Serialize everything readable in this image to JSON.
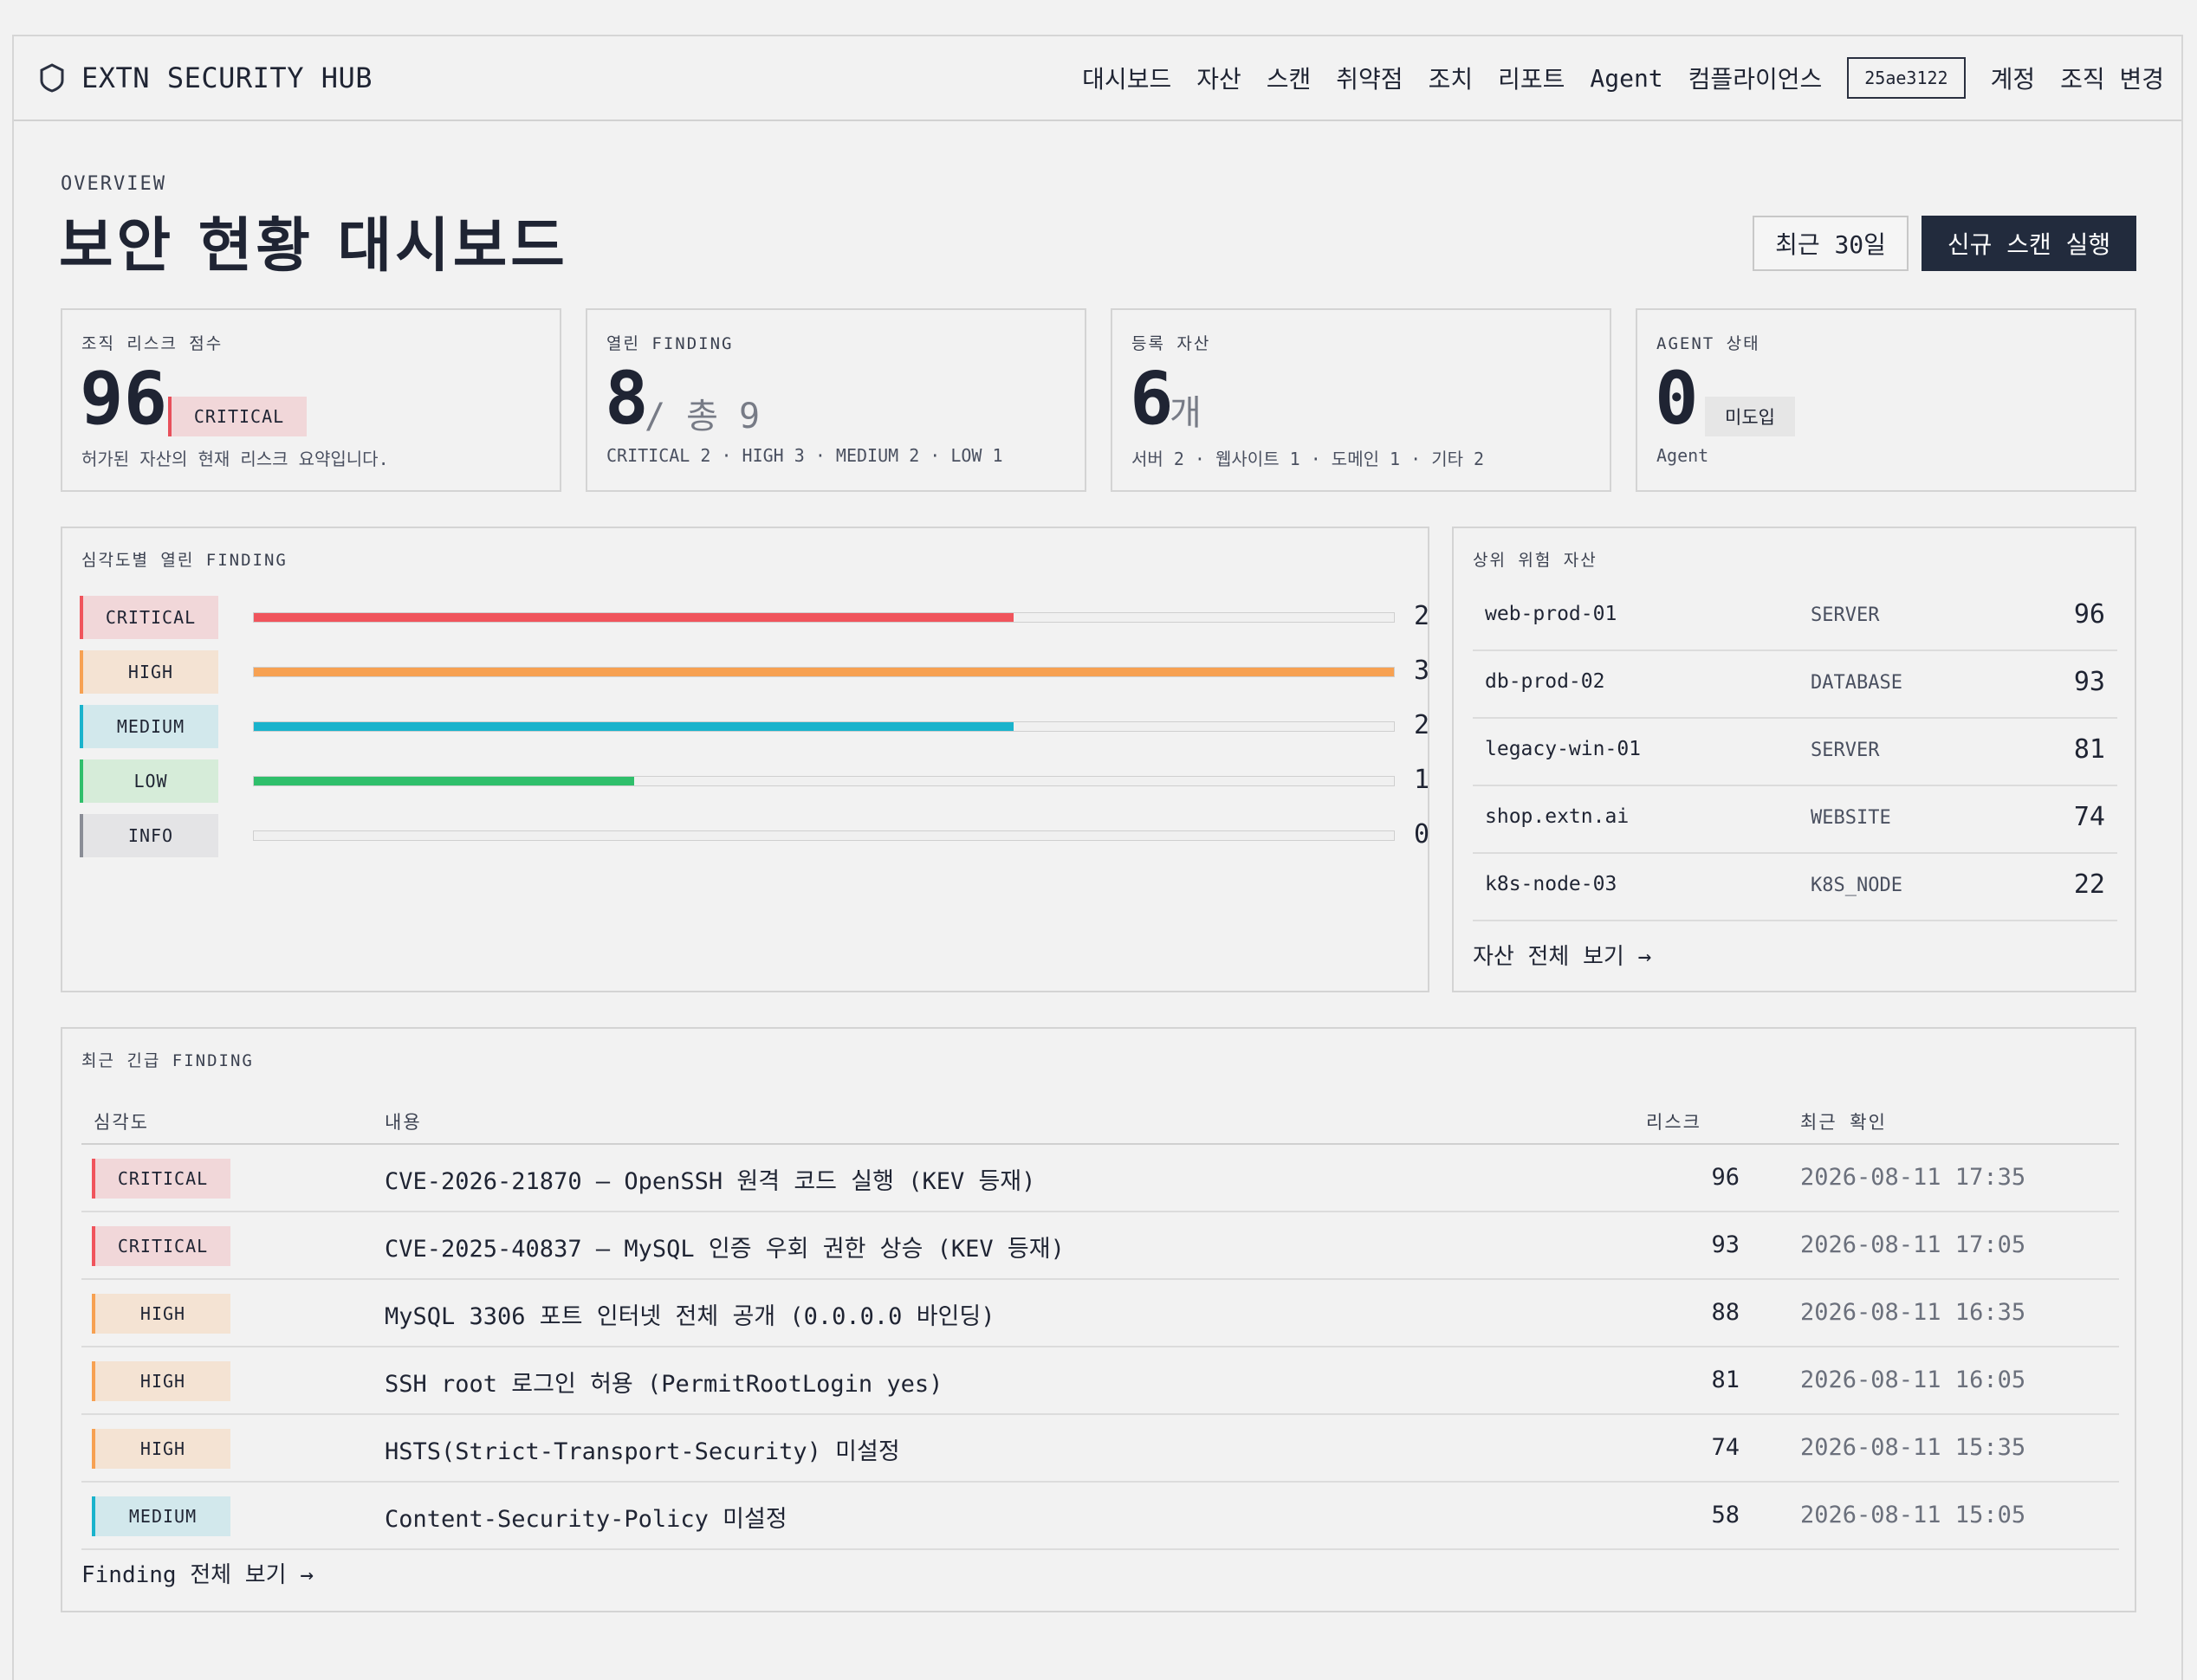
{
  "brand": {
    "name": "EXTN SECURITY HUB",
    "icon": "shield-icon"
  },
  "nav": {
    "items": [
      "대시보드",
      "자산",
      "스캔",
      "취약점",
      "조치",
      "리포트",
      "Agent",
      "컴플라이언스"
    ],
    "org_id": "25ae3122",
    "account": "계정",
    "switch_org": "조직 변경"
  },
  "page": {
    "eyebrow": "OVERVIEW",
    "title": "보안 현황 대시보드",
    "period_button": "최근 30일",
    "scan_button": "신규 스캔 실행"
  },
  "cards": {
    "risk": {
      "label": "조직 리스크 점수",
      "value": "96",
      "badge": "CRITICAL",
      "desc": "허가된 자산의 현재 리스크 요약입니다."
    },
    "findings": {
      "label": "열린 FINDING",
      "value": "8",
      "suffix": "/ 총 9",
      "desc": "CRITICAL 2 · HIGH 3 · MEDIUM 2 · LOW 1"
    },
    "assets": {
      "label": "등록 자산",
      "value": "6",
      "suffix": "개",
      "desc": "서버 2 · 웹사이트 1 · 도메인 1 · 기타 2"
    },
    "agent": {
      "label": "AGENT 상태",
      "value": "0",
      "badge": "미도입",
      "desc": "Agent"
    }
  },
  "severity_panel": {
    "label": "심각도별 열린 FINDING",
    "max": 3,
    "rows": [
      {
        "name": "CRITICAL",
        "count": 2,
        "color": "#f0545c",
        "bg": "#f1d7d9"
      },
      {
        "name": "HIGH",
        "count": 3,
        "color": "#f7a152",
        "bg": "#f4e3d3"
      },
      {
        "name": "MEDIUM",
        "count": 2,
        "color": "#1ab3cc",
        "bg": "#d2e8ec"
      },
      {
        "name": "LOW",
        "count": 1,
        "color": "#2fbf6b",
        "bg": "#d6ecd9"
      },
      {
        "name": "INFO",
        "count": 0,
        "color": "#8a8d96",
        "bg": "#e4e4e6"
      }
    ]
  },
  "assets_panel": {
    "label": "상위 위험 자산",
    "rows": [
      {
        "name": "web-prod-01",
        "type": "SERVER",
        "score": "96"
      },
      {
        "name": "db-prod-02",
        "type": "DATABASE",
        "score": "93"
      },
      {
        "name": "legacy-win-01",
        "type": "SERVER",
        "score": "81"
      },
      {
        "name": "shop.extn.ai",
        "type": "WEBSITE",
        "score": "74"
      },
      {
        "name": "k8s-node-03",
        "type": "K8S_NODE",
        "score": "22"
      }
    ],
    "link": "자산 전체 보기 →"
  },
  "urgent_panel": {
    "label": "최근 긴급 FINDING",
    "headers": {
      "severity": "심각도",
      "content": "내용",
      "risk": "리스크",
      "last_seen": "최근 확인"
    },
    "rows": [
      {
        "severity": "CRITICAL",
        "content": "CVE-2026-21870 — OpenSSH 원격 코드 실행 (KEV 등재)",
        "risk": "96",
        "date": "2026-08-11 17:35"
      },
      {
        "severity": "CRITICAL",
        "content": "CVE-2025-40837 — MySQL 인증 우회 권한 상승 (KEV 등재)",
        "risk": "93",
        "date": "2026-08-11 17:05"
      },
      {
        "severity": "HIGH",
        "content": "MySQL 3306 포트 인터넷 전체 공개 (0.0.0.0 바인딩)",
        "risk": "88",
        "date": "2026-08-11 16:35"
      },
      {
        "severity": "HIGH",
        "content": "SSH root 로그인 허용 (PermitRootLogin yes)",
        "risk": "81",
        "date": "2026-08-11 16:05"
      },
      {
        "severity": "HIGH",
        "content": "HSTS(Strict-Transport-Security) 미설정",
        "risk": "74",
        "date": "2026-08-11 15:35"
      },
      {
        "severity": "MEDIUM",
        "content": "Content-Security-Policy 미설정",
        "risk": "58",
        "date": "2026-08-11 15:05"
      }
    ],
    "link": "Finding 전체 보기 →"
  }
}
